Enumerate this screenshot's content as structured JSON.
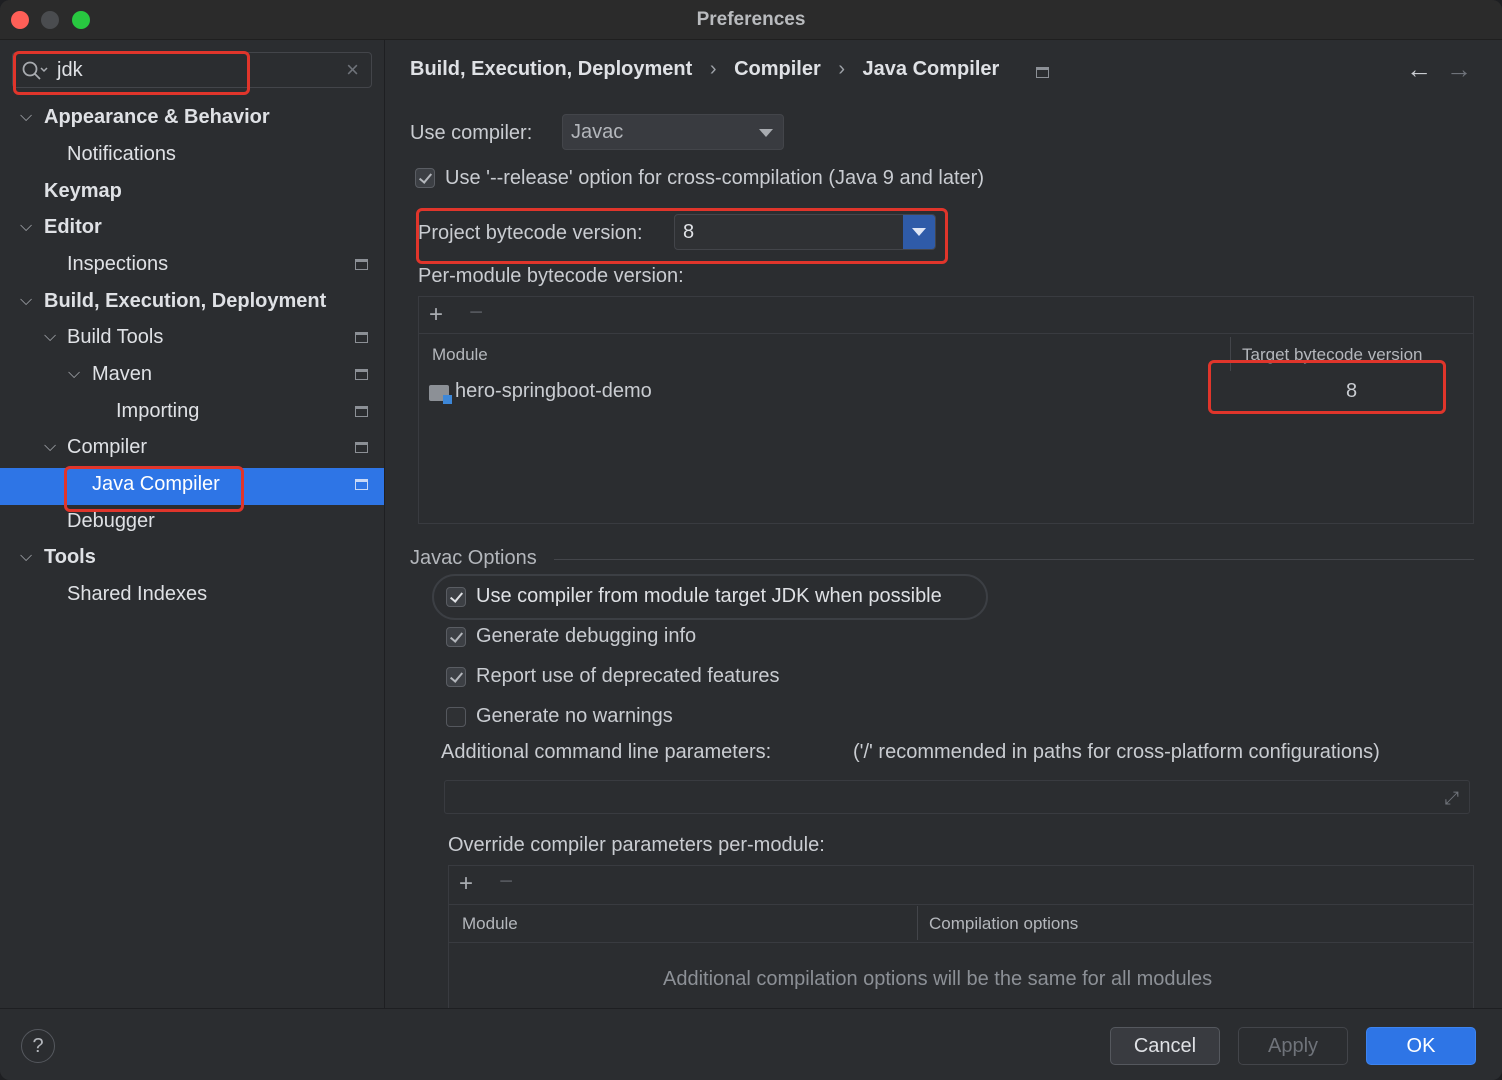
{
  "window": {
    "title": "Preferences"
  },
  "search": {
    "value": "jdk"
  },
  "sidebar": {
    "items": [
      {
        "label": "Appearance & Behavior",
        "expanded": true,
        "bold": true
      },
      {
        "label": "Notifications"
      },
      {
        "label": "Keymap",
        "bold": true
      },
      {
        "label": "Editor",
        "expanded": true,
        "bold": true
      },
      {
        "label": "Inspections"
      },
      {
        "label": "Build, Execution, Deployment",
        "expanded": true,
        "bold": true
      },
      {
        "label": "Build Tools",
        "expanded": true
      },
      {
        "label": "Maven",
        "expanded": true
      },
      {
        "label": "Importing"
      },
      {
        "label": "Compiler",
        "expanded": true
      },
      {
        "label": "Java Compiler",
        "selected": true
      },
      {
        "label": "Debugger"
      },
      {
        "label": "Tools",
        "expanded": true,
        "bold": true
      },
      {
        "label": "Shared Indexes"
      }
    ]
  },
  "breadcrumb": [
    "Build, Execution, Deployment",
    "Compiler",
    "Java Compiler"
  ],
  "compiler": {
    "use_compiler_label": "Use compiler:",
    "use_compiler_value": "Javac",
    "release_option_label": "Use '--release' option for cross-compilation (Java 9 and later)",
    "release_option_checked": true,
    "project_bytecode_label": "Project bytecode version:",
    "project_bytecode_value": "8",
    "per_module_label": "Per-module bytecode version:",
    "module_table": {
      "headers": [
        "Module",
        "Target bytecode version"
      ],
      "rows": [
        {
          "module": "hero-springboot-demo",
          "target": "8"
        }
      ]
    }
  },
  "javac": {
    "group_title": "Javac Options",
    "options": [
      {
        "label": "Use compiler from module target JDK when possible",
        "checked": true
      },
      {
        "label": "Generate debugging info",
        "checked": true
      },
      {
        "label": "Report use of deprecated features",
        "checked": true
      },
      {
        "label": "Generate no warnings",
        "checked": false
      }
    ],
    "additional_params_label": "Additional command line parameters:",
    "additional_params_hint": "('/' recommended in paths for cross-platform configurations)",
    "additional_params_value": "",
    "override_label": "Override compiler parameters per-module:",
    "override_table": {
      "headers": [
        "Module",
        "Compilation options"
      ],
      "empty_text": "Additional compilation options will be the same for all modules"
    }
  },
  "footer": {
    "help_label": "?",
    "cancel_label": "Cancel",
    "apply_label": "Apply",
    "ok_label": "OK"
  },
  "colors": {
    "accent": "#2e75e6",
    "highlight_box": "#e0352b",
    "background": "#2b2d30"
  }
}
